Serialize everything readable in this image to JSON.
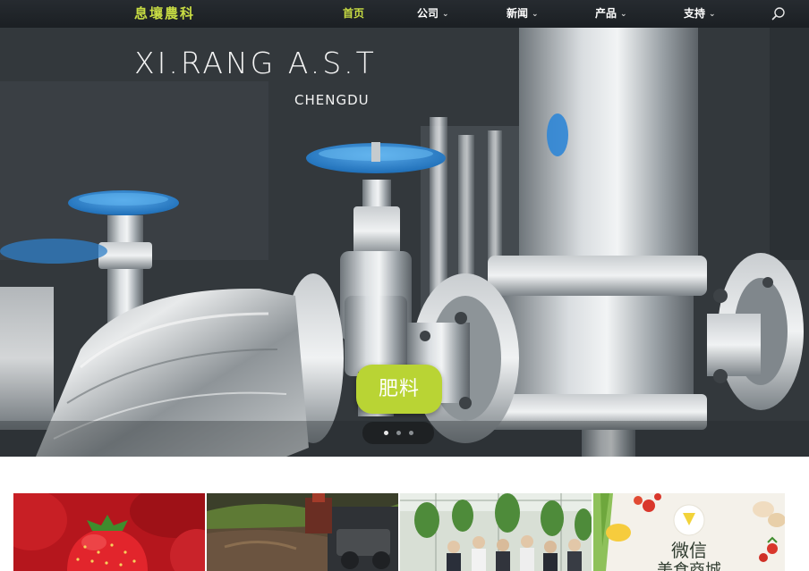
{
  "nav": {
    "logo": "息壤農科",
    "items": [
      {
        "label": "首页",
        "active": true,
        "has_dropdown": false
      },
      {
        "label": "公司",
        "active": false,
        "has_dropdown": true
      },
      {
        "label": "新闻",
        "active": false,
        "has_dropdown": true
      },
      {
        "label": "产品",
        "active": false,
        "has_dropdown": true
      },
      {
        "label": "支持",
        "active": false,
        "has_dropdown": true
      }
    ],
    "search_icon": "search-icon",
    "chevron_icon": "chevron-down-icon"
  },
  "hero": {
    "brand": "XI.RANG A.S.T",
    "city": "CHENGDU",
    "slide_button": "肥料",
    "slide_count": 3,
    "active_slide": 1
  },
  "tiles": [
    {
      "name": "strawberries"
    },
    {
      "name": "soil-tilling"
    },
    {
      "name": "greenhouse-visit"
    },
    {
      "name": "wechat-mall",
      "title": "微信",
      "subtitle": "美食商城"
    }
  ],
  "colors": {
    "accent": "#c8dd43",
    "button": "#b9d434",
    "nav_bg": "#1f2327"
  }
}
